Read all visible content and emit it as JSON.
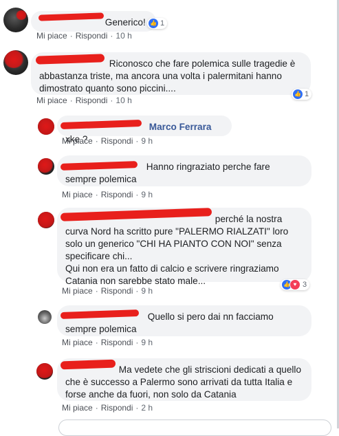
{
  "comments": [
    {
      "text": "Generico!",
      "actions": {
        "like": "Mi piace",
        "reply": "Rispondi",
        "time": "10 h"
      },
      "reactions": {
        "count": "1"
      }
    },
    {
      "text": "Riconosco che fare polemica sulle tragedie è abbastanza triste, ma ancora una volta i palermitani hanno dimostrato quanto sono piccini....",
      "actions": {
        "like": "Mi piace",
        "reply": "Rispondi",
        "time": "10 h"
      },
      "reactions": {
        "count": "1"
      }
    },
    {
      "mention": "Marco Ferrara",
      "text": " xke ?",
      "actions": {
        "like": "Mi piace",
        "reply": "Rispondi",
        "time": "9 h"
      }
    },
    {
      "text": "Hanno ringraziato perche fare sempre polemica",
      "actions": {
        "like": "Mi piace",
        "reply": "Rispondi",
        "time": "9 h"
      }
    },
    {
      "text": "perché la nostra curva Nord ha scritto pure \"PALERMO RIALZATI\" loro solo un generico \"CHI HA PIANTO CON NOI\" senza specificare chi...",
      "text2": "Qui non era un fatto di calcio e scrivere ringraziamo Catania non sarebbe stato male...",
      "actions": {
        "like": "Mi piace",
        "reply": "Rispondi",
        "time": "9 h"
      },
      "reactions": {
        "count": "3"
      }
    },
    {
      "text": "Quello si pero dai nn facciamo sempre polemica",
      "actions": {
        "like": "Mi piace",
        "reply": "Rispondi",
        "time": "9 h"
      }
    },
    {
      "text": "Ma vedete che gli striscioni dedicati a quello che è successo a Palermo sono arrivati da tutta Italia e forse anche da fuori, non solo da Catania",
      "actions": {
        "like": "Mi piace",
        "reply": "Rispondi",
        "time": "2 h"
      }
    }
  ],
  "icons": {
    "like": "thumbs-up-icon",
    "love": "heart-icon"
  },
  "colors": {
    "redaction": "#e8201c",
    "link": "#385898",
    "bubble": "#f2f3f5",
    "like": "#2f6ff6",
    "love": "#f33e58"
  }
}
